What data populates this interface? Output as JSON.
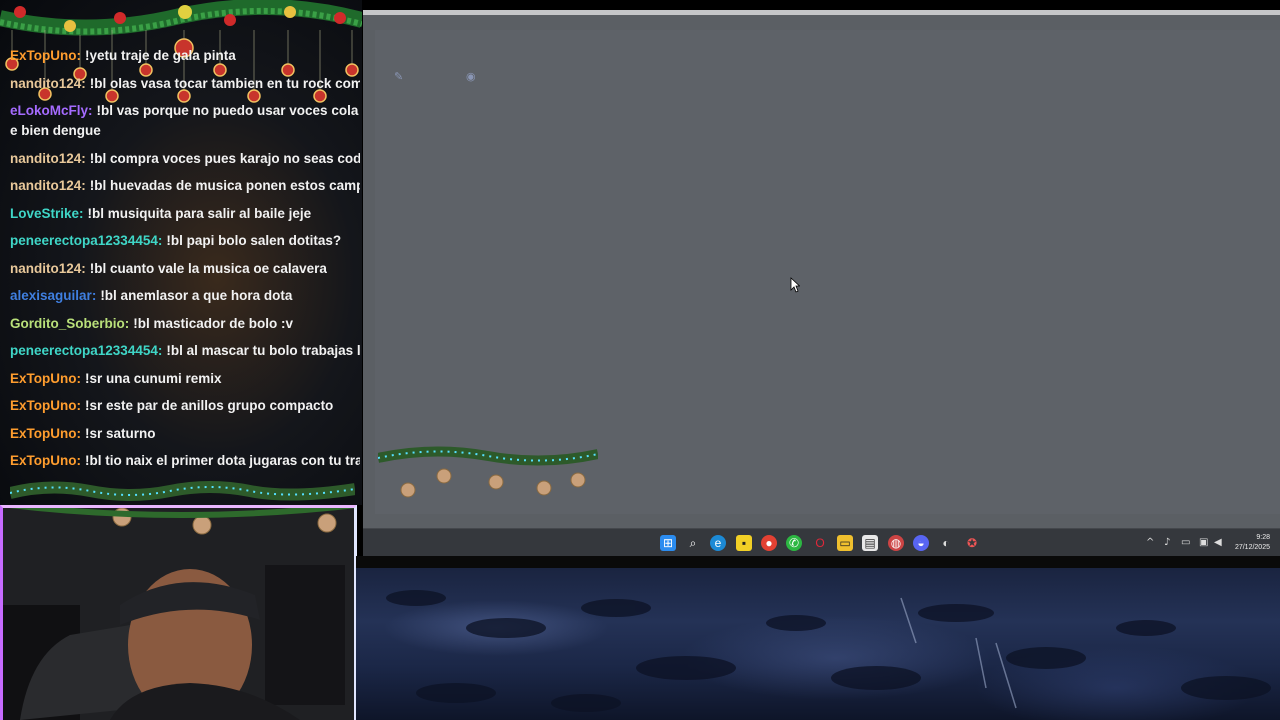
{
  "chat": {
    "messages": [
      {
        "user": "ExTopUno",
        "text": "!yetu traje de gala pinta",
        "color": "#ff9d2e"
      },
      {
        "user": "nandito124",
        "text": "!bl olas vasa tocar tambien en tu rock comi",
        "color": "#e8c89a"
      },
      {
        "user": "eLokoMcFly",
        "text": "!bl vas porque no puedo usar voces cola e bien dengue",
        "color": "#a56bff",
        "wrap": true
      },
      {
        "user": "nandito124",
        "text": "!bl compra voces pues karajo no seas codo mier",
        "color": "#e8c89a"
      },
      {
        "user": "nandito124",
        "text": "!bl huevadas de musica ponen estos campesino",
        "color": "#e8c89a"
      },
      {
        "user": "LoveStrike",
        "text": "!bl musiquita para salir al baile jeje",
        "color": "#3fd6c7"
      },
      {
        "user": "peneerectopa12334454",
        "text": "!bl papi bolo salen dotitas?",
        "color": "#3fd6c7"
      },
      {
        "user": "nandito124",
        "text": "!bl cuanto vale la musica oe calavera",
        "color": "#e8c89a"
      },
      {
        "user": "alexisaguilar",
        "text": "!bl anemlasor a que hora dota",
        "color": "#3f7fe0"
      },
      {
        "user": "Gordito_Soberbio",
        "text": "!bl masticador de bolo :v",
        "color": "#b9e07a"
      },
      {
        "user": "peneerectopa12334454",
        "text": "!bl al mascar tu bolo trabajas la cara",
        "color": "#3fd6c7"
      },
      {
        "user": "ExTopUno",
        "text": "!sr una cunumi remix",
        "color": "#ff9d2e"
      },
      {
        "user": "ExTopUno",
        "text": "!sr este par de anillos grupo compacto",
        "color": "#ff9d2e"
      },
      {
        "user": "ExTopUno",
        "text": "!sr saturno",
        "color": "#ff9d2e"
      },
      {
        "user": "ExTopUno",
        "text": "!bl tio naix el primer dota jugaras con tu traje con",
        "color": "#ff9d2e"
      }
    ]
  },
  "taskbar": {
    "icons": [
      "windows-start-icon",
      "search-icon",
      "edge-browser-icon",
      "sticky-notes-icon",
      "chrome-icon",
      "whatsapp-icon",
      "opera-icon",
      "file-explorer-icon",
      "store-icon",
      "app-icon",
      "discord-icon",
      "obs-icon",
      "game-icon"
    ],
    "time": "9:28",
    "date": "27/12/2025"
  },
  "colors": {
    "app_bg": "#5e6268",
    "taskbar_bg": "#35383d",
    "webcam_border": "#c66bff"
  }
}
